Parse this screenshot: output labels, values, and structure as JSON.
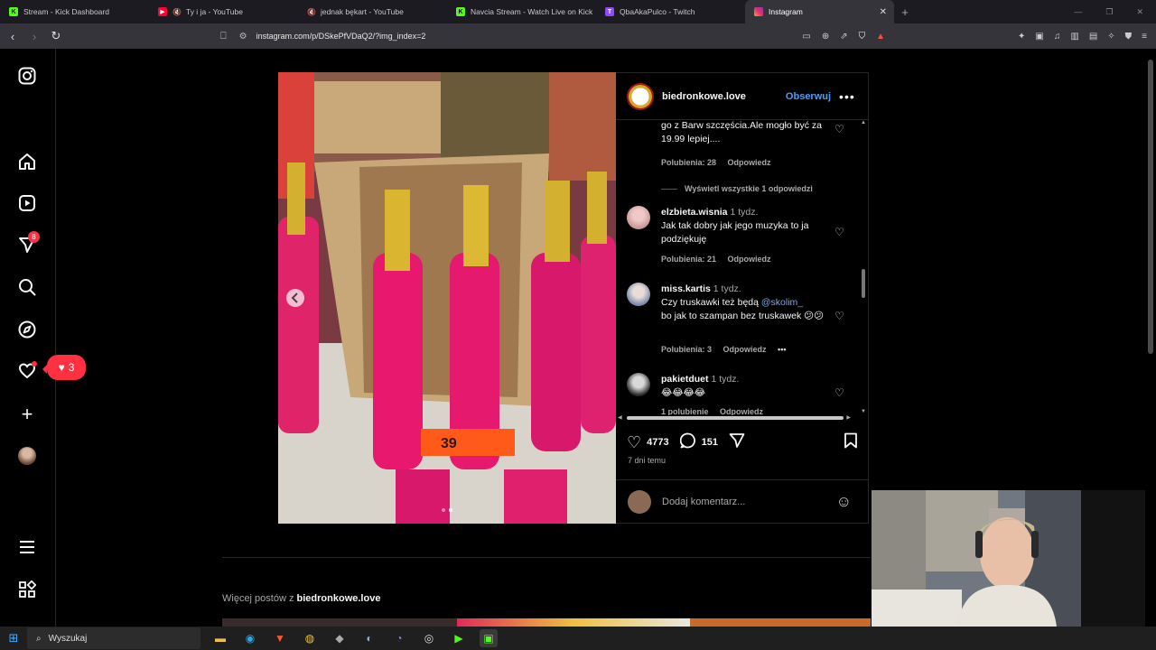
{
  "browser": {
    "tabs": [
      {
        "label": "Stream - Kick Dashboard",
        "favicon": "kick-icon",
        "color": "#53fc18"
      },
      {
        "label": "Ty i ja - YouTube",
        "favicon": "youtube-icon",
        "color": "#ff0033",
        "muted": true
      },
      {
        "label": "jednak bękart - YouTube",
        "favicon": "youtube-icon",
        "color": "#ff0033",
        "muted": true
      },
      {
        "label": "Navcia Stream - Watch Live on Kick",
        "favicon": "kick-icon",
        "color": "#53fc18"
      },
      {
        "label": "QbaAkaPulco - Twitch",
        "favicon": "twitch-icon",
        "color": "#9146ff"
      },
      {
        "label": "Instagram",
        "favicon": "instagram-icon",
        "color": "#e1306c",
        "active": true
      }
    ],
    "url": "instagram.com/p/DSkePfVDaQ2/?img_index=2"
  },
  "sidebar": {
    "notifications_badge": "8",
    "likes_count": "3"
  },
  "post": {
    "username": "biedronkowe.love",
    "follow_label": "Obserwuj",
    "price_tag": "39",
    "likes": "4773",
    "comments_count": "151",
    "date": "7 dni temu",
    "add_comment_placeholder": "Dodaj komentarz...",
    "comments": [
      {
        "text": "go z Barw szczęścia.Ale mogło być za 19.99 lepiej....",
        "likes": "Polubienia: 28",
        "reply": "Odpowiedz"
      },
      {
        "view_replies": "Wyświetl wszystkie 1 odpowiedzi"
      },
      {
        "user": "elzbieta.wisnia",
        "time": "1 tydz.",
        "text": "Jak tak dobry jak jego muzyka to ja podziękuję",
        "likes": "Polubienia: 21",
        "reply": "Odpowiedz"
      },
      {
        "user": "miss.kartis",
        "time": "1 tydz.",
        "text_before": "Czy truskawki też będą ",
        "mention": "@skolim_",
        "text_after": "bo jak to szampan bez truskawek 😕😕",
        "likes": "Polubienia: 3",
        "reply": "Odpowiedz"
      },
      {
        "user": "pakietduet",
        "time": "1 tydz.",
        "text": "😂😂😂😂",
        "likes": "1 polubienie",
        "reply": "Odpowiedz"
      }
    ]
  },
  "more_posts": {
    "prefix": "Więcej postów z ",
    "username": "biedronkowe.love"
  },
  "taskbar": {
    "search_placeholder": "Wyszukaj"
  }
}
